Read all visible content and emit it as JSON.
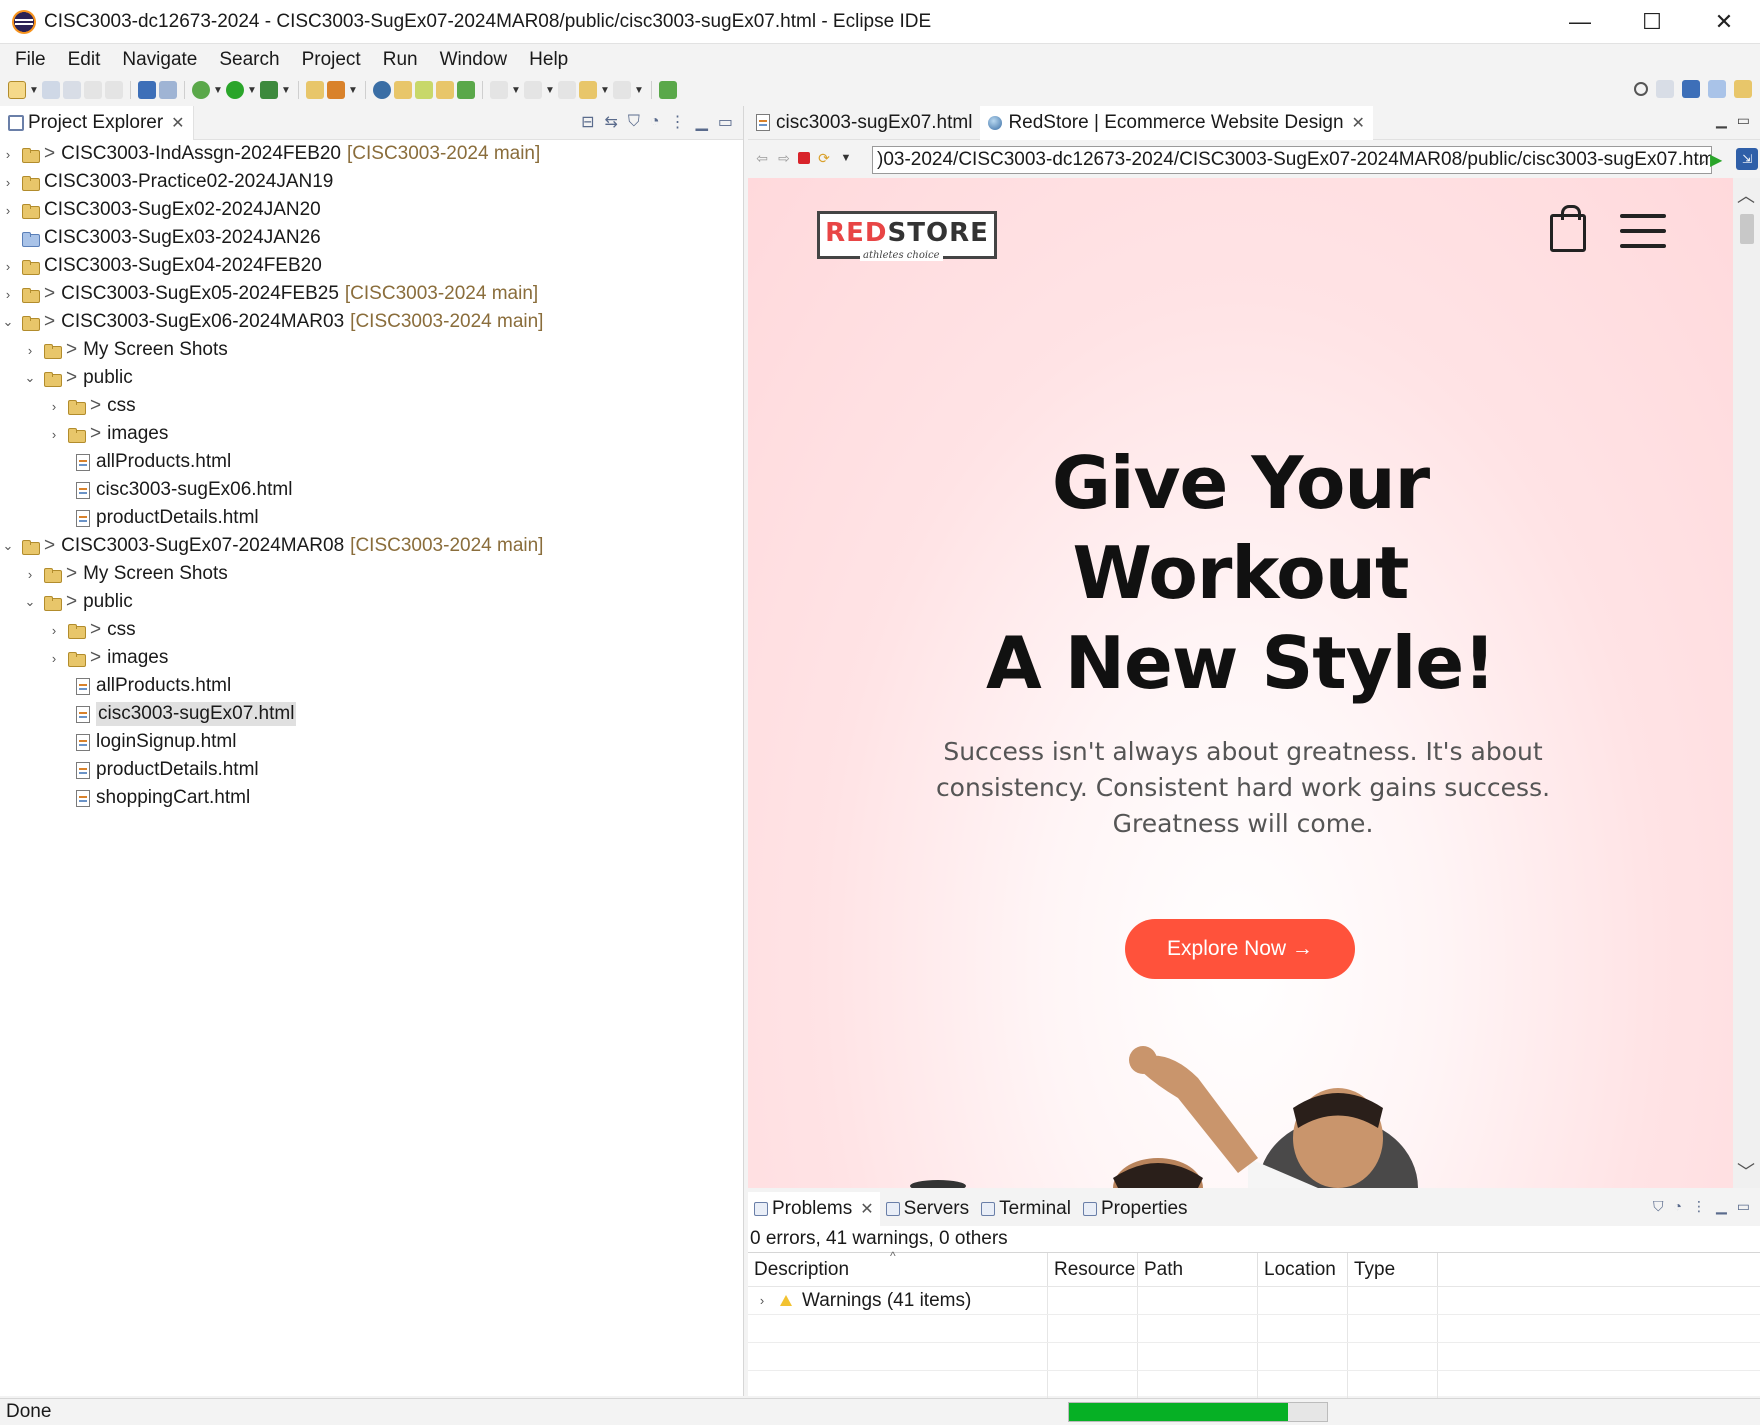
{
  "window": {
    "title": "CISC3003-dc12673-2024 - CISC3003-SugEx07-2024MAR08/public/cisc3003-sugEx07.html - Eclipse IDE",
    "minimize": "—",
    "maximize": "☐",
    "close": "✕"
  },
  "menu": [
    "File",
    "Edit",
    "Navigate",
    "Search",
    "Project",
    "Run",
    "Window",
    "Help"
  ],
  "project_explorer": {
    "tab_label": "Project Explorer",
    "items": [
      {
        "label": "CISC3003-IndAssgn-2024FEB20",
        "git": "[CISC3003-2024 main]"
      },
      {
        "label": "CISC3003-Practice02-2024JAN19"
      },
      {
        "label": "CISC3003-SugEx02-2024JAN20"
      },
      {
        "label": "CISC3003-SugEx03-2024JAN26"
      },
      {
        "label": "CISC3003-SugEx04-2024FEB20"
      },
      {
        "label": "CISC3003-SugEx05-2024FEB25",
        "git": "[CISC3003-2024 main]"
      },
      {
        "label": "CISC3003-SugEx06-2024MAR03",
        "git": "[CISC3003-2024 main]"
      },
      {
        "label": "My Screen Shots"
      },
      {
        "label": "public"
      },
      {
        "label": "css"
      },
      {
        "label": "images"
      },
      {
        "label": "allProducts.html"
      },
      {
        "label": "cisc3003-sugEx06.html"
      },
      {
        "label": "productDetails.html"
      },
      {
        "label": "CISC3003-SugEx07-2024MAR08",
        "git": "[CISC3003-2024 main]"
      },
      {
        "label": "My Screen Shots"
      },
      {
        "label": "public"
      },
      {
        "label": "css"
      },
      {
        "label": "images"
      },
      {
        "label": "allProducts.html"
      },
      {
        "label": "cisc3003-sugEx07.html"
      },
      {
        "label": "loginSignup.html"
      },
      {
        "label": "productDetails.html"
      },
      {
        "label": "shoppingCart.html"
      }
    ]
  },
  "editor": {
    "tabs": [
      "cisc3003-sugEx07.html",
      "RedStore | Ecommerce Website Design"
    ],
    "url": ")03-2024/CISC3003-dc12673-2024/CISC3003-SugEx07-2024MAR08/public/cisc3003-sugEx07.html"
  },
  "page": {
    "logo_red": "RED",
    "logo_dark": "STORE",
    "logo_tag": "athletes choice",
    "hero_line1": "Give Your",
    "hero_line2": "Workout",
    "hero_line3": "A New Style!",
    "hero_sub": "Success isn't always about greatness. It's about consistency. Consistent hard work gains success. Greatness will come.",
    "cta": "Explore Now →"
  },
  "bottom_panel": {
    "tabs": [
      "Problems",
      "Servers",
      "Terminal",
      "Properties"
    ],
    "summary": "0 errors, 41 warnings, 0 others",
    "columns": [
      "Description",
      "Resource",
      "Path",
      "Location",
      "Type"
    ],
    "rows": [
      {
        "description": "Warnings (41 items)"
      }
    ]
  },
  "status": {
    "text": "Done",
    "progress": 0.85
  },
  "colors": {
    "accent": "#ff523b",
    "progress": "#06b025",
    "git_decoration": "#8a6d3b"
  }
}
